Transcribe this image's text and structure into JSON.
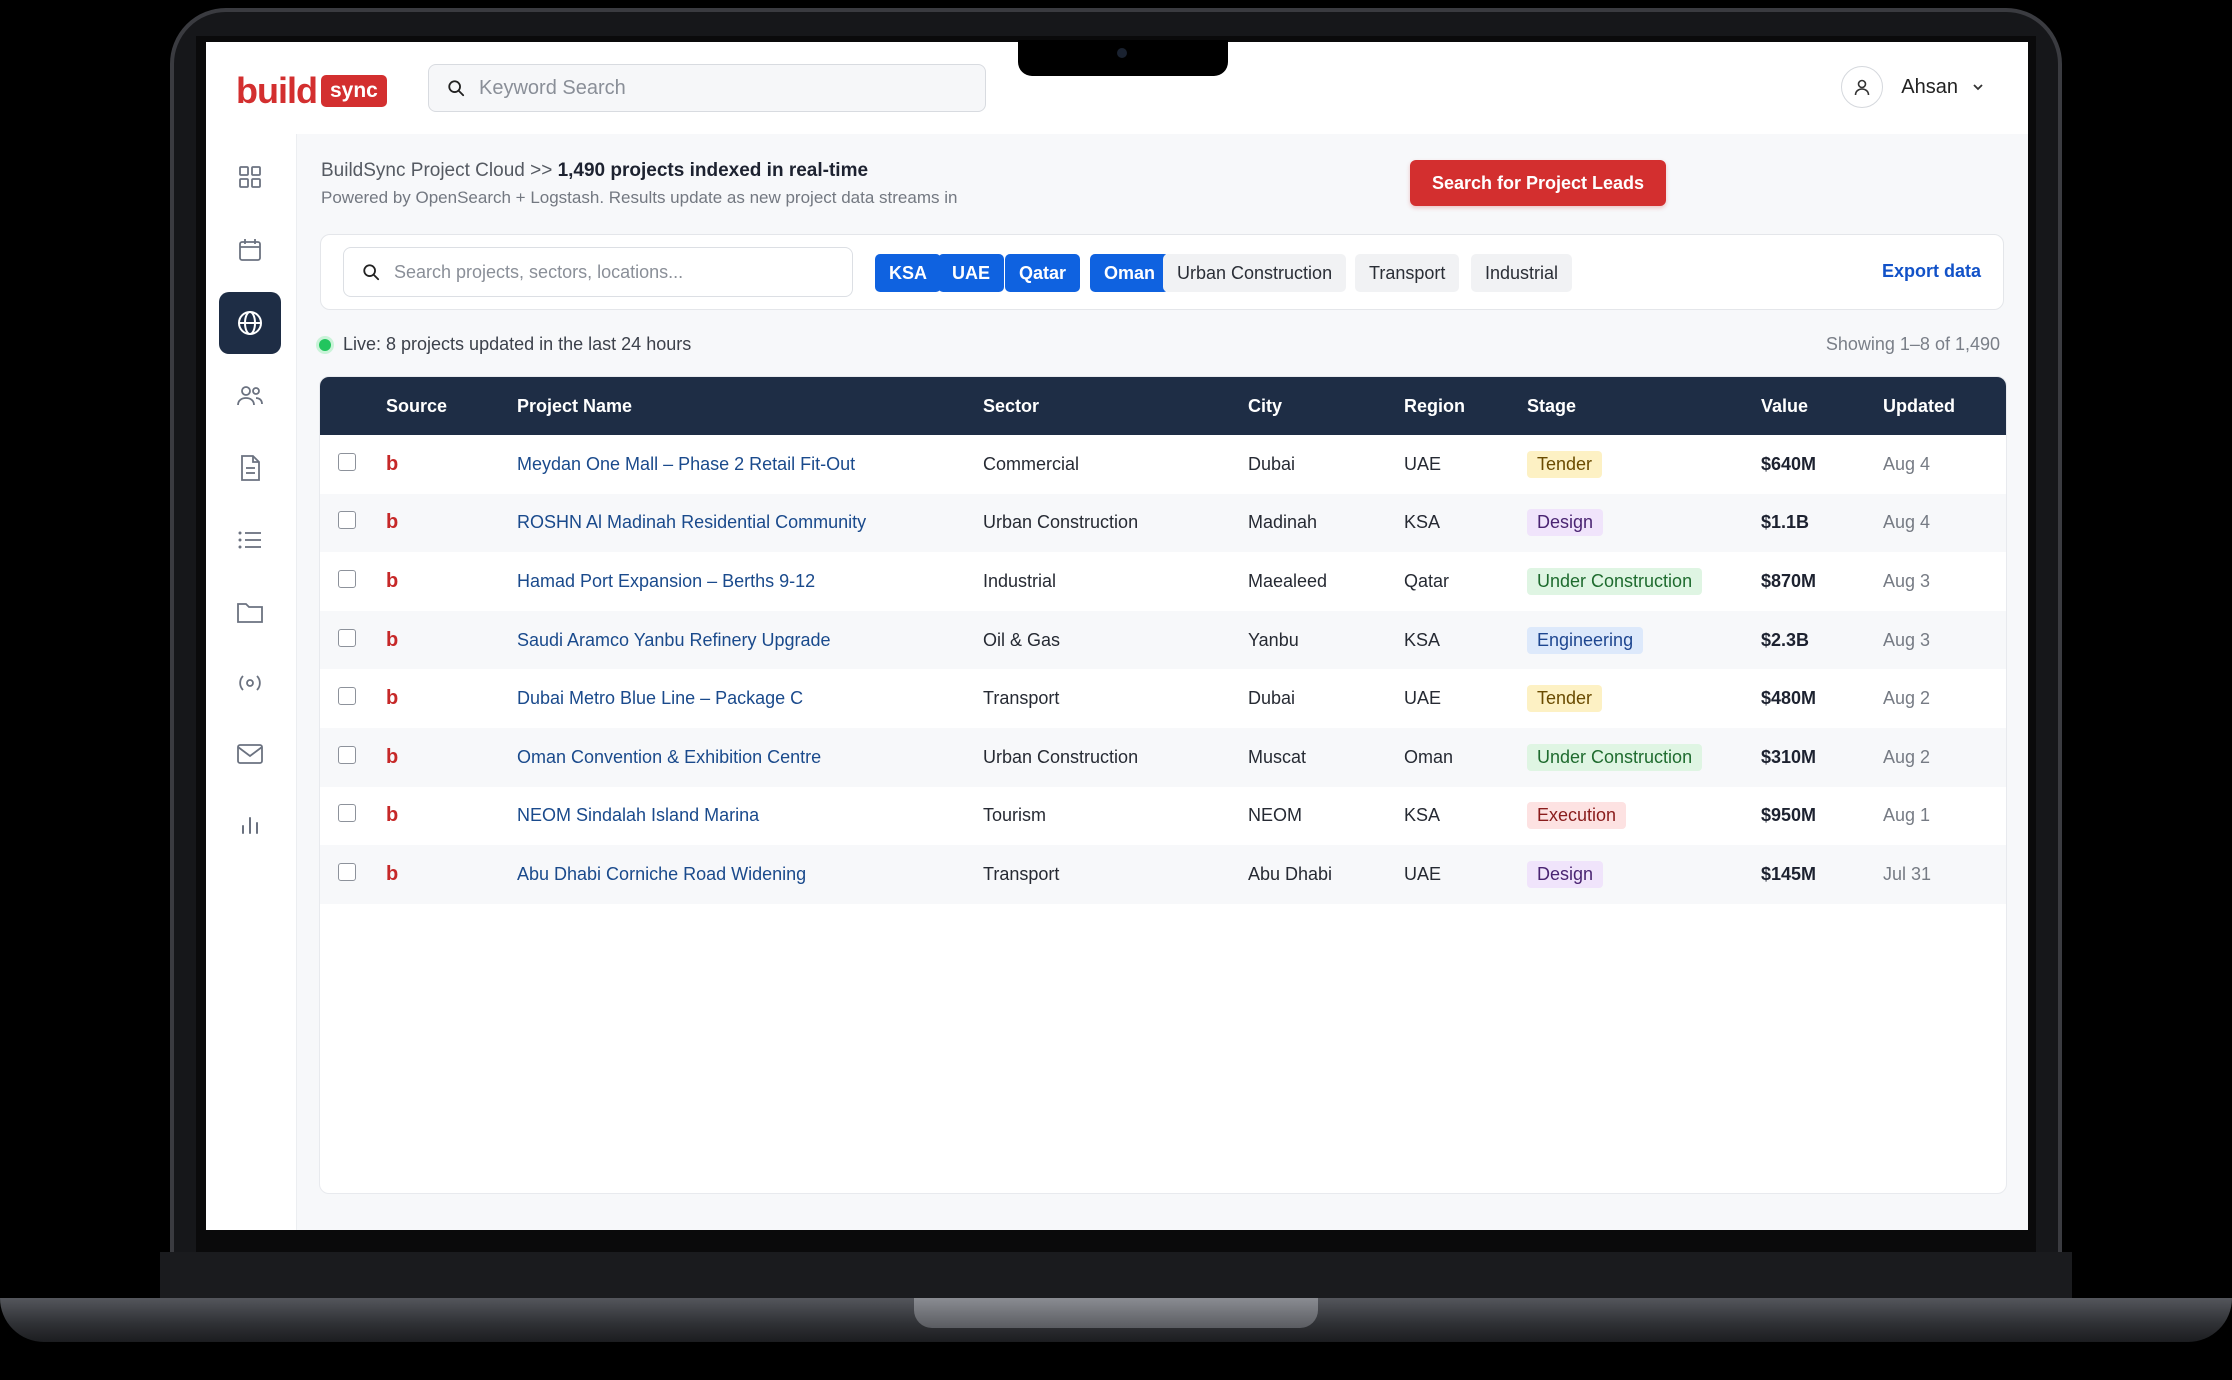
{
  "app": {
    "logo_text": "build",
    "logo_badge": "sync",
    "brand_color": "#d32f2f"
  },
  "topbar": {
    "search_placeholder": "Keyword Search",
    "user_name": "Ahsan"
  },
  "sidebar": {
    "items": [
      "dashboard-grid-icon",
      "calendar-icon",
      "globe-icon",
      "users-icon",
      "document-icon",
      "list-icon",
      "folder-icon",
      "broadcast-icon",
      "mail-icon",
      "bar-chart-icon"
    ],
    "active_index": 2
  },
  "header": {
    "breadcrumb": "BuildSync Project Cloud >>",
    "headline": "1,490 projects indexed in real-time",
    "subtitle": "Powered by OpenSearch + Logstash. Results update as new project data streams in",
    "cta_label": "Search for Project Leads"
  },
  "filters": {
    "search_placeholder": "Search projects, sectors, locations...",
    "chips": [
      {
        "label": "KSA",
        "active": true
      },
      {
        "label": "UAE",
        "active": true
      },
      {
        "label": "Qatar",
        "active": true
      },
      {
        "label": "Oman",
        "active": true
      },
      {
        "label": "Urban Construction",
        "active": false
      },
      {
        "label": "Transport",
        "active": false
      },
      {
        "label": "Industrial",
        "active": false
      }
    ],
    "export_label": "Export data"
  },
  "status": {
    "live_text": "Live: 8 projects updated in the last 24 hours",
    "showing_text": "Showing 1–8 of 1,490"
  },
  "table": {
    "headers": [
      "Source",
      "Project Name",
      "Sector",
      "City",
      "Region",
      "Stage",
      "Value",
      "Updated"
    ],
    "rows": [
      {
        "source": "b",
        "name": "Meydan One Mall – Phase 2 Retail Fit-Out",
        "sector": "Commercial",
        "city": "Dubai",
        "region": "UAE",
        "stage": "Tender",
        "stage_color": "#fdf1c4",
        "value": "$640M",
        "updated": "Aug 4"
      },
      {
        "source": "b",
        "name": "ROSHN Al Madinah Residential Community",
        "sector": "Urban Construction",
        "city": "Madinah",
        "region": "KSA",
        "stage": "Design",
        "stage_color": "#f0e4fb",
        "value": "$1.1B",
        "updated": "Aug 4"
      },
      {
        "source": "b",
        "name": "Hamad Port Expansion – Berths 9-12",
        "sector": "Industrial",
        "city": "Maealeed",
        "region": "Qatar",
        "stage": "Under Construction",
        "stage_color": "#dff5e3",
        "value": "$870M",
        "updated": "Aug 3"
      },
      {
        "source": "b",
        "name": "Saudi Aramco Yanbu Refinery Upgrade",
        "sector": "Oil & Gas",
        "city": "Yanbu",
        "region": "KSA",
        "stage": "Engineering",
        "stage_color": "#dde9fb",
        "value": "$2.3B",
        "updated": "Aug 3"
      },
      {
        "source": "b",
        "name": "Dubai Metro Blue Line – Package C",
        "sector": "Transport",
        "city": "Dubai",
        "region": "UAE",
        "stage": "Tender",
        "stage_color": "#fdf1c4",
        "value": "$480M",
        "updated": "Aug 2"
      },
      {
        "source": "b",
        "name": "Oman Convention & Exhibition Centre",
        "sector": "Urban Construction",
        "city": "Muscat",
        "region": "Oman",
        "stage": "Under Construction",
        "stage_color": "#dff5e3",
        "value": "$310M",
        "updated": "Aug 2"
      },
      {
        "source": "b",
        "name": "NEOM Sindalah Island Marina",
        "sector": "Tourism",
        "city": "NEOM",
        "region": "KSA",
        "stage": "Execution",
        "stage_color": "#fde2e2",
        "value": "$950M",
        "updated": "Aug 1"
      },
      {
        "source": "b",
        "name": "Abu Dhabi Corniche Road Widening",
        "sector": "Transport",
        "city": "Abu Dhabi",
        "region": "UAE",
        "stage": "Design",
        "stage_color": "#f0e4fb",
        "value": "$145M",
        "updated": "Jul 31"
      }
    ]
  }
}
